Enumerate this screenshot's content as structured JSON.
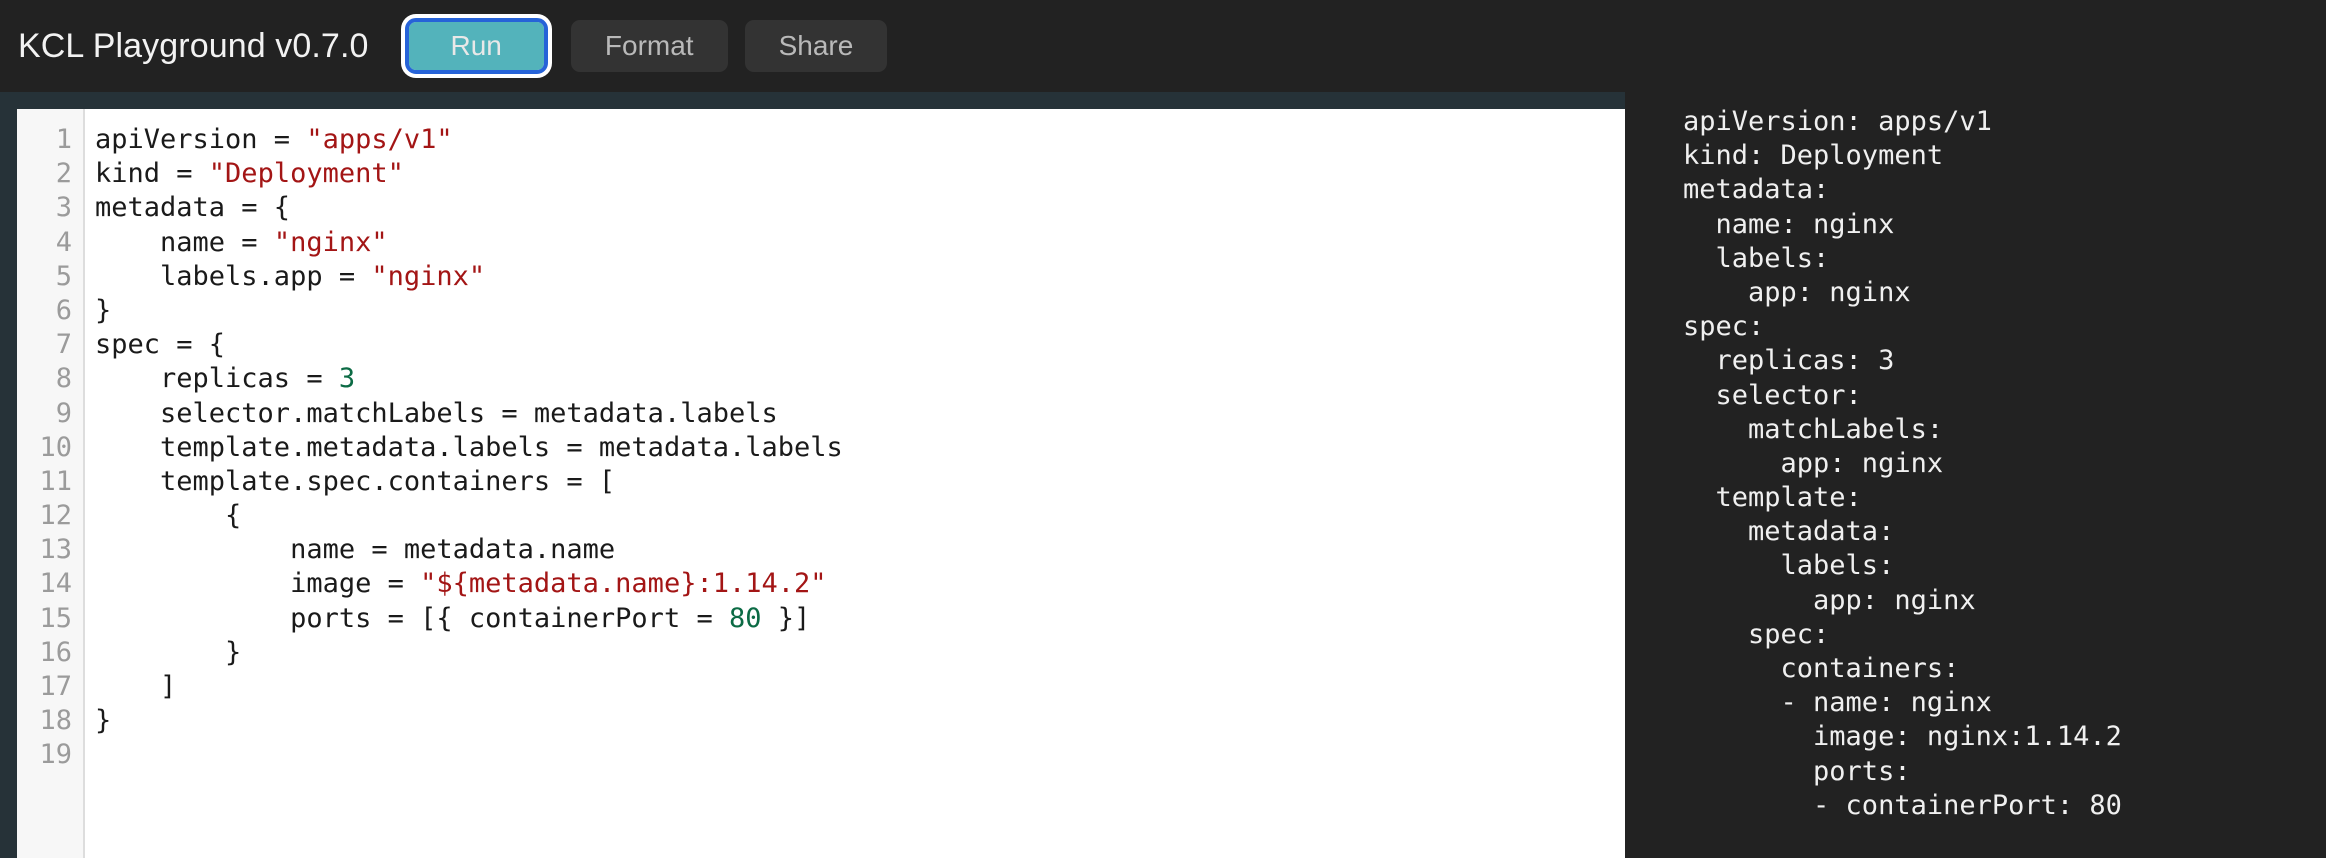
{
  "header": {
    "app_title": "KCL Playground v0.7.0",
    "buttons": [
      {
        "label": "Run",
        "name": "run-button",
        "variant": "primary"
      },
      {
        "label": "Format",
        "name": "format-button",
        "variant": "secondary"
      },
      {
        "label": "Share",
        "name": "share-button",
        "variant": "secondary"
      }
    ]
  },
  "colors": {
    "app_background": "#222222",
    "header_background": "#222222",
    "editor_frame": "#263238",
    "editor_background": "#ffffff",
    "gutter_background": "#f7f7f7",
    "gutter_text": "#9b9b9b",
    "code_text": "#1a1a1a",
    "string_token": "#a31515",
    "number_token": "#0c6b45",
    "run_button_background": "#53b3bb",
    "run_button_focus_ring": "#2663d8",
    "secondary_button_background": "#333333",
    "secondary_button_text": "#b9b9b9",
    "output_background": "#222222",
    "output_text": "#f0f0f0"
  },
  "editor": {
    "language": "kcl",
    "line_numbers": [
      "1",
      "2",
      "3",
      "4",
      "5",
      "6",
      "7",
      "8",
      "9",
      "10",
      "11",
      "12",
      "13",
      "14",
      "15",
      "16",
      "17",
      "18",
      "19"
    ],
    "lines": [
      {
        "n": "1",
        "tokens": [
          {
            "t": "apiVersion = ",
            "k": "plain"
          },
          {
            "t": "\"apps/v1\"",
            "k": "str"
          }
        ]
      },
      {
        "n": "2",
        "tokens": [
          {
            "t": "kind = ",
            "k": "plain"
          },
          {
            "t": "\"Deployment\"",
            "k": "str"
          }
        ]
      },
      {
        "n": "3",
        "tokens": [
          {
            "t": "metadata = {",
            "k": "plain"
          }
        ]
      },
      {
        "n": "4",
        "tokens": [
          {
            "t": "    name = ",
            "k": "plain"
          },
          {
            "t": "\"nginx\"",
            "k": "str"
          }
        ]
      },
      {
        "n": "5",
        "tokens": [
          {
            "t": "    labels.app = ",
            "k": "plain"
          },
          {
            "t": "\"nginx\"",
            "k": "str"
          }
        ]
      },
      {
        "n": "6",
        "tokens": [
          {
            "t": "}",
            "k": "plain"
          }
        ]
      },
      {
        "n": "7",
        "tokens": [
          {
            "t": "spec = {",
            "k": "plain"
          }
        ]
      },
      {
        "n": "8",
        "tokens": [
          {
            "t": "    replicas = ",
            "k": "plain"
          },
          {
            "t": "3",
            "k": "num"
          }
        ]
      },
      {
        "n": "9",
        "tokens": [
          {
            "t": "    selector.matchLabels = metadata.labels",
            "k": "plain"
          }
        ]
      },
      {
        "n": "10",
        "tokens": [
          {
            "t": "    template.metadata.labels = metadata.labels",
            "k": "plain"
          }
        ]
      },
      {
        "n": "11",
        "tokens": [
          {
            "t": "    template.spec.containers = [",
            "k": "plain"
          }
        ]
      },
      {
        "n": "12",
        "tokens": [
          {
            "t": "        {",
            "k": "plain"
          }
        ]
      },
      {
        "n": "13",
        "tokens": [
          {
            "t": "            name = metadata.name",
            "k": "plain"
          }
        ]
      },
      {
        "n": "14",
        "tokens": [
          {
            "t": "            image = ",
            "k": "plain"
          },
          {
            "t": "\"${metadata.name}:1.14.2\"",
            "k": "str"
          }
        ]
      },
      {
        "n": "15",
        "tokens": [
          {
            "t": "            ports = [{ containerPort = ",
            "k": "plain"
          },
          {
            "t": "80",
            "k": "num"
          },
          {
            "t": " }]",
            "k": "plain"
          }
        ]
      },
      {
        "n": "16",
        "tokens": [
          {
            "t": "        }",
            "k": "plain"
          }
        ]
      },
      {
        "n": "17",
        "tokens": [
          {
            "t": "    ]",
            "k": "plain"
          }
        ]
      },
      {
        "n": "18",
        "tokens": [
          {
            "t": "}",
            "k": "plain"
          }
        ]
      },
      {
        "n": "19",
        "tokens": [
          {
            "t": "",
            "k": "plain"
          }
        ]
      }
    ]
  },
  "output": {
    "format": "yaml",
    "lines": [
      "apiVersion: apps/v1",
      "kind: Deployment",
      "metadata:",
      "  name: nginx",
      "  labels:",
      "    app: nginx",
      "spec:",
      "  replicas: 3",
      "  selector:",
      "    matchLabels:",
      "      app: nginx",
      "  template:",
      "    metadata:",
      "      labels:",
      "        app: nginx",
      "    spec:",
      "      containers:",
      "      - name: nginx",
      "        image: nginx:1.14.2",
      "        ports:",
      "        - containerPort: 80"
    ]
  }
}
